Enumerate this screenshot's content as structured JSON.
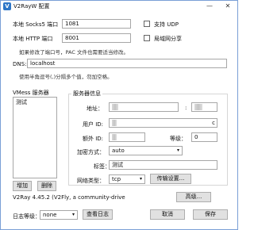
{
  "window": {
    "title": "V2RayW 配置",
    "minimize": "—",
    "close": "✕",
    "app_icon": "V"
  },
  "local": {
    "socks_label": "本地 Socks5 端口",
    "socks_value": "1081",
    "http_label": "本地 HTTP 端口",
    "http_value": "8001",
    "udp_label": "支持 UDP",
    "lan_label": "局域网分享",
    "port_hint": "如果修改了端口号，PAC 文件也需要适当修改。"
  },
  "dns": {
    "label": "DNS:",
    "value": "localhost",
    "hint": "使用半角逗号(,)分隔多个值，勿加空格。"
  },
  "servers": {
    "group_title": "VMess 服务器",
    "items": [
      "测试"
    ],
    "add_button": "增加",
    "delete_button": "删除"
  },
  "server_info": {
    "group_title": "服务器信息",
    "address_label": "地址：",
    "address_value": "",
    "port_sep": ":",
    "port_value": "",
    "userid_label": "用户 ID:",
    "userid_value": "",
    "userid_tail": "c",
    "extra_id_label": "额外 ID:",
    "extra_id_value": "",
    "level_label": "等级：",
    "level_value": "0",
    "security_label": "加密方式：",
    "security_value": "auto",
    "tag_label": "标签：",
    "tag_value": "测试",
    "network_label": "网络类型：",
    "network_value": "tcp",
    "transport_button": "传输设置..."
  },
  "footer": {
    "version": "V2Ray 4.45.2 (V2Fly, a community-drive",
    "advanced_button": "高级...",
    "log_level_label": "日志等级：",
    "log_level_value": "none",
    "view_log_button": "查看日志",
    "cancel_button": "取消",
    "save_button": "保存"
  }
}
